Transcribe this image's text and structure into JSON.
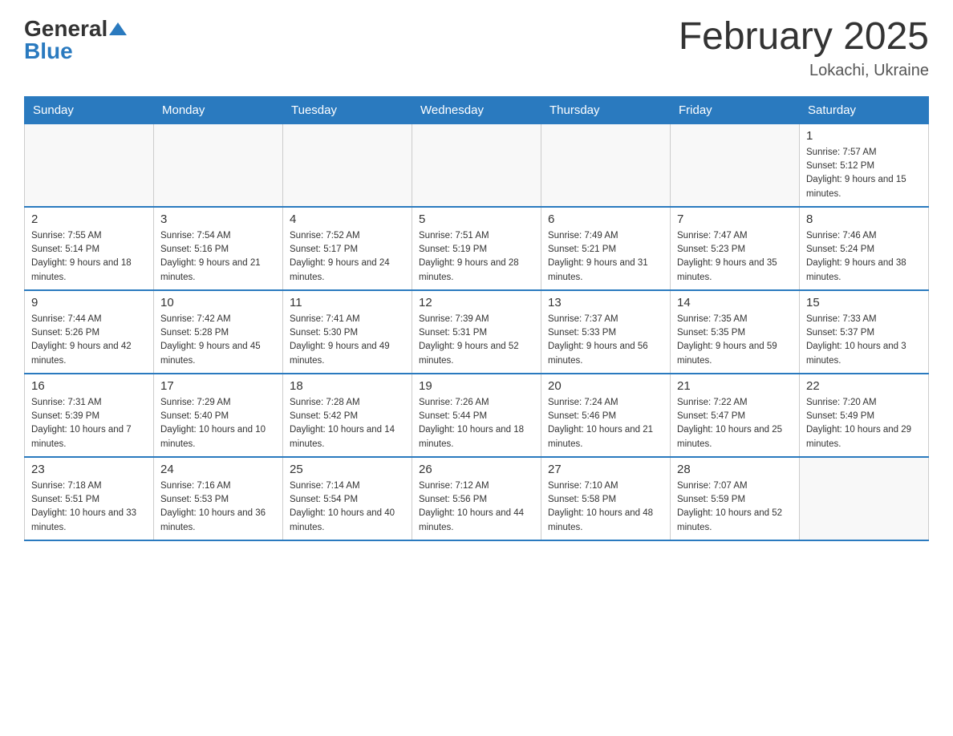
{
  "header": {
    "logo_general": "General",
    "logo_blue": "Blue",
    "month_title": "February 2025",
    "location": "Lokachi, Ukraine"
  },
  "days_of_week": [
    "Sunday",
    "Monday",
    "Tuesday",
    "Wednesday",
    "Thursday",
    "Friday",
    "Saturday"
  ],
  "weeks": [
    [
      {
        "day": "",
        "info": ""
      },
      {
        "day": "",
        "info": ""
      },
      {
        "day": "",
        "info": ""
      },
      {
        "day": "",
        "info": ""
      },
      {
        "day": "",
        "info": ""
      },
      {
        "day": "",
        "info": ""
      },
      {
        "day": "1",
        "info": "Sunrise: 7:57 AM\nSunset: 5:12 PM\nDaylight: 9 hours and 15 minutes."
      }
    ],
    [
      {
        "day": "2",
        "info": "Sunrise: 7:55 AM\nSunset: 5:14 PM\nDaylight: 9 hours and 18 minutes."
      },
      {
        "day": "3",
        "info": "Sunrise: 7:54 AM\nSunset: 5:16 PM\nDaylight: 9 hours and 21 minutes."
      },
      {
        "day": "4",
        "info": "Sunrise: 7:52 AM\nSunset: 5:17 PM\nDaylight: 9 hours and 24 minutes."
      },
      {
        "day": "5",
        "info": "Sunrise: 7:51 AM\nSunset: 5:19 PM\nDaylight: 9 hours and 28 minutes."
      },
      {
        "day": "6",
        "info": "Sunrise: 7:49 AM\nSunset: 5:21 PM\nDaylight: 9 hours and 31 minutes."
      },
      {
        "day": "7",
        "info": "Sunrise: 7:47 AM\nSunset: 5:23 PM\nDaylight: 9 hours and 35 minutes."
      },
      {
        "day": "8",
        "info": "Sunrise: 7:46 AM\nSunset: 5:24 PM\nDaylight: 9 hours and 38 minutes."
      }
    ],
    [
      {
        "day": "9",
        "info": "Sunrise: 7:44 AM\nSunset: 5:26 PM\nDaylight: 9 hours and 42 minutes."
      },
      {
        "day": "10",
        "info": "Sunrise: 7:42 AM\nSunset: 5:28 PM\nDaylight: 9 hours and 45 minutes."
      },
      {
        "day": "11",
        "info": "Sunrise: 7:41 AM\nSunset: 5:30 PM\nDaylight: 9 hours and 49 minutes."
      },
      {
        "day": "12",
        "info": "Sunrise: 7:39 AM\nSunset: 5:31 PM\nDaylight: 9 hours and 52 minutes."
      },
      {
        "day": "13",
        "info": "Sunrise: 7:37 AM\nSunset: 5:33 PM\nDaylight: 9 hours and 56 minutes."
      },
      {
        "day": "14",
        "info": "Sunrise: 7:35 AM\nSunset: 5:35 PM\nDaylight: 9 hours and 59 minutes."
      },
      {
        "day": "15",
        "info": "Sunrise: 7:33 AM\nSunset: 5:37 PM\nDaylight: 10 hours and 3 minutes."
      }
    ],
    [
      {
        "day": "16",
        "info": "Sunrise: 7:31 AM\nSunset: 5:39 PM\nDaylight: 10 hours and 7 minutes."
      },
      {
        "day": "17",
        "info": "Sunrise: 7:29 AM\nSunset: 5:40 PM\nDaylight: 10 hours and 10 minutes."
      },
      {
        "day": "18",
        "info": "Sunrise: 7:28 AM\nSunset: 5:42 PM\nDaylight: 10 hours and 14 minutes."
      },
      {
        "day": "19",
        "info": "Sunrise: 7:26 AM\nSunset: 5:44 PM\nDaylight: 10 hours and 18 minutes."
      },
      {
        "day": "20",
        "info": "Sunrise: 7:24 AM\nSunset: 5:46 PM\nDaylight: 10 hours and 21 minutes."
      },
      {
        "day": "21",
        "info": "Sunrise: 7:22 AM\nSunset: 5:47 PM\nDaylight: 10 hours and 25 minutes."
      },
      {
        "day": "22",
        "info": "Sunrise: 7:20 AM\nSunset: 5:49 PM\nDaylight: 10 hours and 29 minutes."
      }
    ],
    [
      {
        "day": "23",
        "info": "Sunrise: 7:18 AM\nSunset: 5:51 PM\nDaylight: 10 hours and 33 minutes."
      },
      {
        "day": "24",
        "info": "Sunrise: 7:16 AM\nSunset: 5:53 PM\nDaylight: 10 hours and 36 minutes."
      },
      {
        "day": "25",
        "info": "Sunrise: 7:14 AM\nSunset: 5:54 PM\nDaylight: 10 hours and 40 minutes."
      },
      {
        "day": "26",
        "info": "Sunrise: 7:12 AM\nSunset: 5:56 PM\nDaylight: 10 hours and 44 minutes."
      },
      {
        "day": "27",
        "info": "Sunrise: 7:10 AM\nSunset: 5:58 PM\nDaylight: 10 hours and 48 minutes."
      },
      {
        "day": "28",
        "info": "Sunrise: 7:07 AM\nSunset: 5:59 PM\nDaylight: 10 hours and 52 minutes."
      },
      {
        "day": "",
        "info": ""
      }
    ]
  ]
}
